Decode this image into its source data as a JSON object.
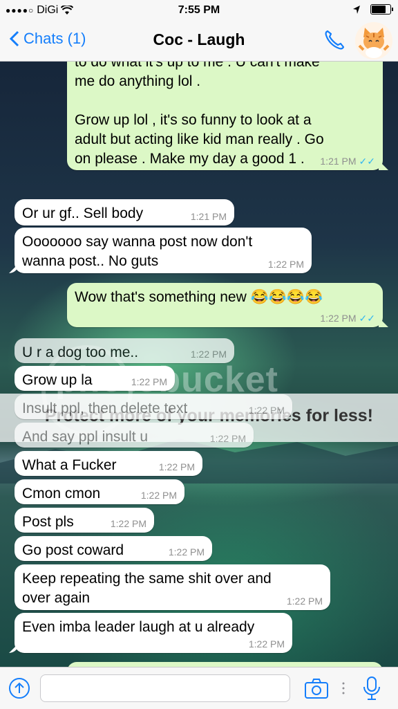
{
  "status": {
    "carrier": "DiGi",
    "signal": "●●●●○",
    "time": "7:55 PM"
  },
  "nav": {
    "back_label": "Chats (1)",
    "title": "Coc - Laugh"
  },
  "watermark": {
    "text": "photobucket",
    "banner": "Protect more of your memories for less!"
  },
  "messages": [
    {
      "side": "out",
      "text": "to do what it's up to me . U can't make\nme do anything lol .\n\nGrow up lol , it's so funny to look at a\nadult but acting like kid man really . Go\non please . Make my day a good 1 .",
      "time": "1:21 PM",
      "read": true
    },
    {
      "side": "in",
      "text": "Or ur gf.. Sell body",
      "time": "1:21 PM"
    },
    {
      "side": "in",
      "text": "Ooooooo say wanna post now don't\nwanna post.. No guts",
      "time": "1:22 PM"
    },
    {
      "side": "out",
      "text": "Wow that's something new 😂😂😂😂",
      "time": "1:22 PM",
      "read": true
    },
    {
      "side": "in",
      "text": "U r a dog too me..",
      "time": "1:22 PM"
    },
    {
      "side": "in",
      "text": "Grow up la",
      "time": "1:22 PM"
    },
    {
      "side": "in",
      "text": "Insult ppl, then delete text",
      "time": "1:22 PM"
    },
    {
      "side": "in",
      "text": "And say ppl insult u",
      "time": "1:22 PM"
    },
    {
      "side": "in",
      "text": "What a Fucker",
      "time": "1:22 PM"
    },
    {
      "side": "in",
      "text": "Cmon cmon",
      "time": "1:22 PM"
    },
    {
      "side": "in",
      "text": "Post pls",
      "time": "1:22 PM"
    },
    {
      "side": "in",
      "text": "Go post coward",
      "time": "1:22 PM"
    },
    {
      "side": "in",
      "text": "Keep repeating the same shit over and\nover again",
      "time": "1:22 PM"
    },
    {
      "side": "in",
      "text": "Even imba leader laugh at u already",
      "time": "1:22 PM"
    }
  ],
  "colors": {
    "accent": "#147efb",
    "outgoing": "#dcf8c6",
    "incoming": "#ffffff",
    "read_ticks": "#34b7f1"
  }
}
